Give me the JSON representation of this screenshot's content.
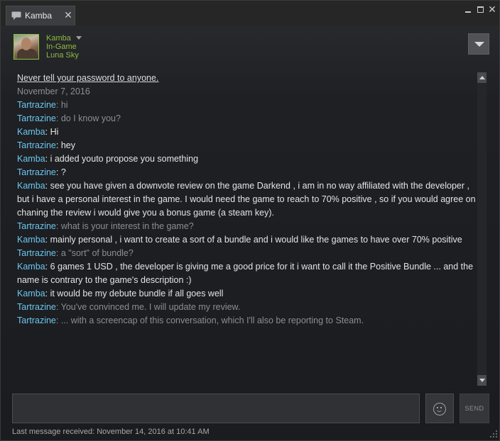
{
  "tab": {
    "title": "Kamba",
    "close": "✕"
  },
  "window_controls": {
    "close": "✕"
  },
  "friend": {
    "name": "Kamba",
    "status": "In-Game",
    "game": "Luna Sky"
  },
  "chat": {
    "warning": "Never tell your password to anyone.",
    "date": "November 7, 2016",
    "messages": [
      {
        "sender": "Tartrazine",
        "text": "hi",
        "type": "in"
      },
      {
        "sender": "Tartrazine",
        "text": "do I know you?",
        "type": "in"
      },
      {
        "sender": "Kamba",
        "text": "Hi",
        "type": "out"
      },
      {
        "sender": "Tartrazine",
        "text": "hey",
        "type": "out"
      },
      {
        "sender": "Kamba",
        "text": "i added youto propose you something",
        "type": "out"
      },
      {
        "sender": "Tartrazine",
        "text": "?",
        "type": "out"
      },
      {
        "sender": "Kamba",
        "text": "see you have given a downvote review on the game Darkend , i am in no way affiliated with the developer , but i have a personal interest in the game. I would need the game to reach to 70% positive , so if you would agree on chaning the review i would give you a bonus game (a steam key).",
        "type": "out"
      },
      {
        "sender": "Tartrazine",
        "text": "what is your interest in the game?",
        "type": "in"
      },
      {
        "sender": "Kamba",
        "text": "mainly personal , i want to create a sort of a bundle and i would like the games to have over 70% positive",
        "type": "out"
      },
      {
        "sender": "Tartrazine",
        "text": "a \"sort\" of bundle?",
        "type": "in"
      },
      {
        "sender": "Kamba",
        "text": "6 games 1 USD , the developer is giving me a good price for it i want to call it the Positive Bundle ... and the name is contrary to the game's description :)",
        "type": "out"
      },
      {
        "sender": "Kamba",
        "text": "it would be my debute bundle if all goes well",
        "type": "out"
      },
      {
        "sender": "Tartrazine",
        "text": "You've convinced me. I will update my review.",
        "type": "in"
      },
      {
        "sender": "Tartrazine",
        "text": "... with a screencap of this conversation, which I'll also be reporting to Steam.",
        "type": "in"
      }
    ]
  },
  "composer": {
    "value": "",
    "send_label": "SEND"
  },
  "footer": {
    "status": "Last message received: November 14, 2016 at 10:41 AM"
  }
}
